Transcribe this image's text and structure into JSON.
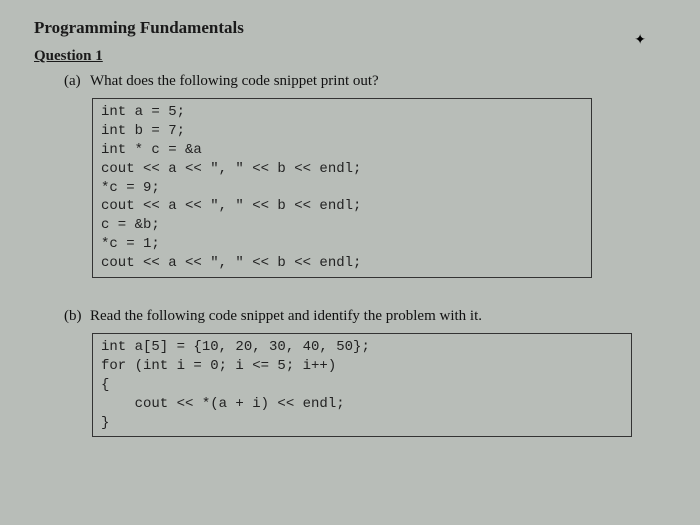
{
  "title": "Programming Fundamentals",
  "question_heading": "Question 1",
  "parts": {
    "a": {
      "label": "(a)",
      "prompt": "What does the following code snippet print out?",
      "code": [
        "int a = 5;",
        "int b = 7;",
        "int * c = &a",
        "cout << a << \", \" << b << endl;",
        "*c = 9;",
        "cout << a << \", \" << b << endl;",
        "c = &b;",
        "*c = 1;",
        "cout << a << \", \" << b << endl;"
      ]
    },
    "b": {
      "label": "(b)",
      "prompt": "Read the following code snippet and identify the problem with it.",
      "code": [
        "int a[5] = {10, 20, 30, 40, 50};",
        "for (int i = 0; i <= 5; i++)",
        "{",
        "    cout << *(a + i) << endl;",
        "}"
      ]
    }
  }
}
